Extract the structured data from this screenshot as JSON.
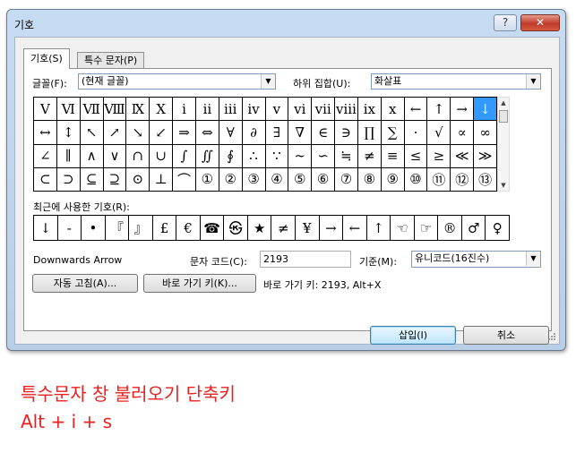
{
  "dialog": {
    "title": "기호",
    "help_icon": "?",
    "close_icon": "✕",
    "tabs": [
      {
        "label": "기호(S)",
        "active": true
      },
      {
        "label": "특수 문자(P)",
        "active": false
      }
    ],
    "font_label": "글꼴(F):",
    "font_value": "(현재 글꼴)",
    "subset_label": "하위 집합(U):",
    "subset_value": "화살표",
    "symbols": [
      [
        "Ⅴ",
        "Ⅵ",
        "Ⅶ",
        "Ⅷ",
        "Ⅸ",
        "Ⅹ",
        "ⅰ",
        "ⅱ",
        "ⅲ",
        "ⅳ",
        "ⅴ",
        "ⅵ",
        "ⅶ",
        "ⅷ",
        "ⅸ",
        "ⅹ",
        "←",
        "↑",
        "→",
        "↓"
      ],
      [
        "↔",
        "↕",
        "↖",
        "↗",
        "↘",
        "↙",
        "⇒",
        "⇔",
        "∀",
        "∂",
        "∃",
        "∇",
        "∈",
        "∋",
        "∏",
        "∑",
        "·",
        "√",
        "∝",
        "∞"
      ],
      [
        "∠",
        "∥",
        "∧",
        "∨",
        "∩",
        "∪",
        "∫",
        "∬",
        "∮",
        "∴",
        "∵",
        "∼",
        "∽",
        "≒",
        "≠",
        "≡",
        "≤",
        "≥",
        "≪",
        "≫"
      ],
      [
        "⊂",
        "⊃",
        "⊆",
        "⊇",
        "⊙",
        "⊥",
        "⌒",
        "①",
        "②",
        "③",
        "④",
        "⑤",
        "⑥",
        "⑦",
        "⑧",
        "⑨",
        "⑩",
        "⑪",
        "⑫",
        "⑬"
      ]
    ],
    "selected_symbol": "↓",
    "recent_label": "최근에 사용한 기호(R):",
    "recent_symbols": [
      "↓",
      "-",
      "•",
      "『",
      "』",
      "£",
      "€",
      "☎",
      "㉿",
      "★",
      "≠",
      "¥",
      "→",
      "←",
      "↑",
      "☜",
      "☞",
      "®",
      "♂",
      "♀"
    ],
    "char_name": "Downwards Arrow",
    "char_code_label": "문자 코드(C):",
    "char_code_value": "2193",
    "from_label": "기준(M):",
    "from_value": "유니코드(16진수)",
    "autocorrect_button": "자동 고침(A)...",
    "shortcut_button": "바로 가기 키(K)...",
    "shortcut_text": "바로 가기 키: 2193, Alt+X",
    "insert_button": "삽입(I)",
    "cancel_button": "취소"
  },
  "caption": {
    "line1": "특수문자 창 불러오기 단축키",
    "line2": "Alt + i + s"
  },
  "colors": {
    "caption": "#e8221f",
    "selection": "#3399ff"
  }
}
